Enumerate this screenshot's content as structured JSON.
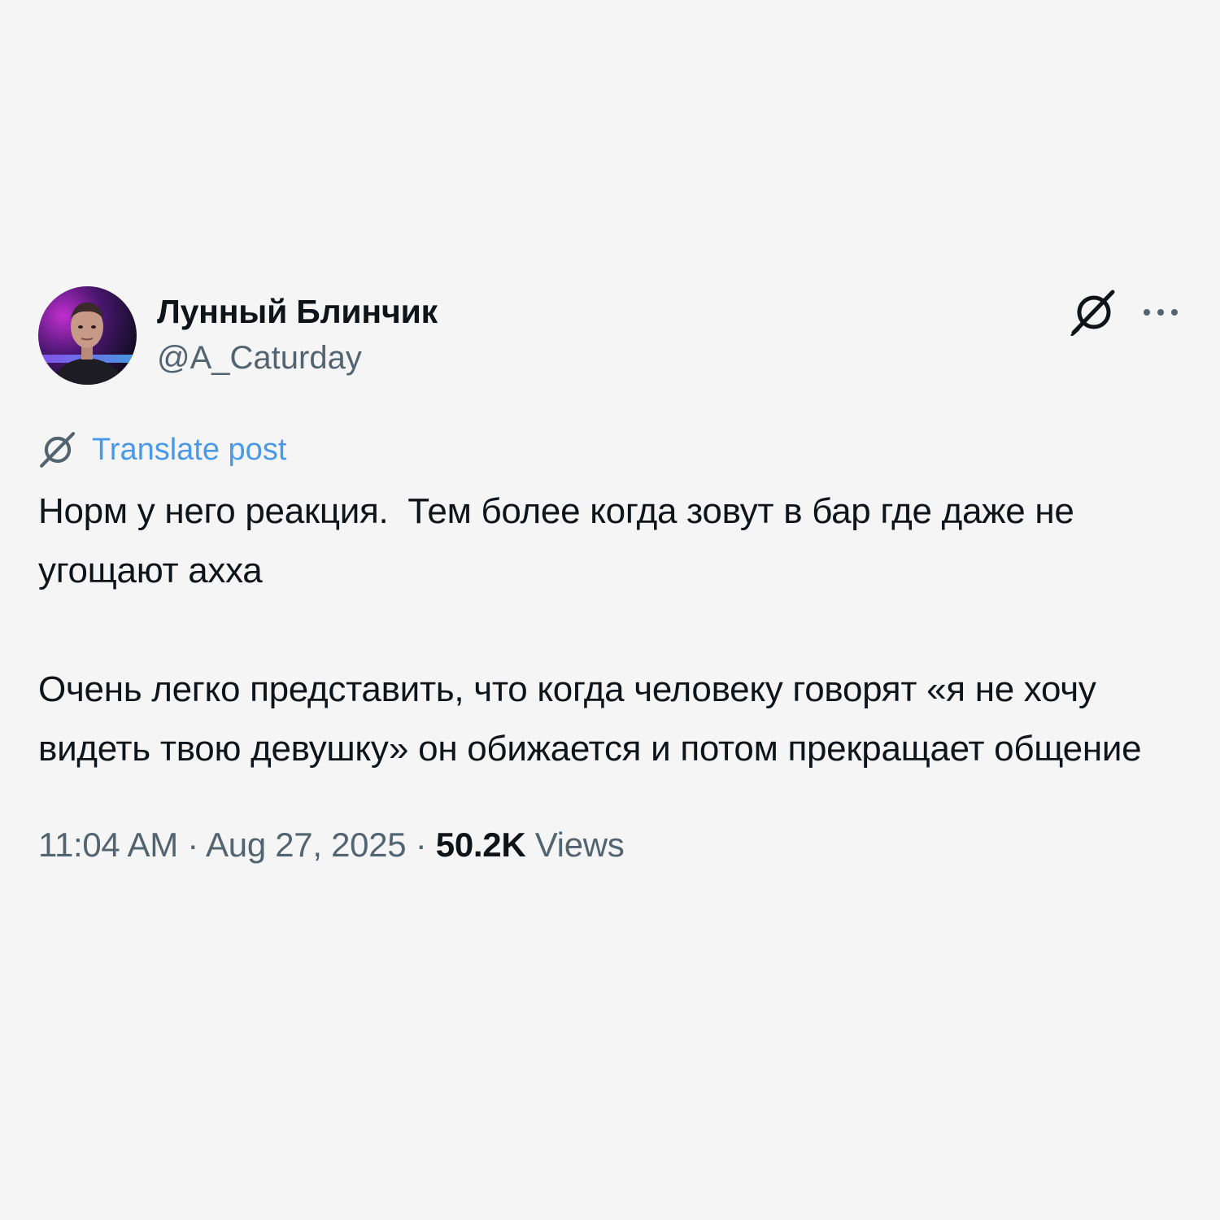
{
  "author": {
    "display_name": "Лунный Блинчик",
    "handle": "@A_Caturday"
  },
  "icons": {
    "grok": "grok-icon",
    "more": "more-dots-icon",
    "translate": "grok-translate-icon"
  },
  "translate_label": "Translate post",
  "post_text": "Норм у него реакция.  Тем более когда зовут в бар где даже не угощают ахха\n\nОчень легко представить, что когда человеку говорят «я не хочу видеть твою девушку» он обижается и потом прекращает общение",
  "meta": {
    "time": "11:04 AM",
    "separator": " · ",
    "date": "Aug 27, 2025",
    "views_count": "50.2K",
    "views_label": " Views"
  },
  "colors": {
    "background": "#f5f5f6",
    "text": "#0f1419",
    "secondary": "#536471",
    "link": "#4a99e9"
  }
}
